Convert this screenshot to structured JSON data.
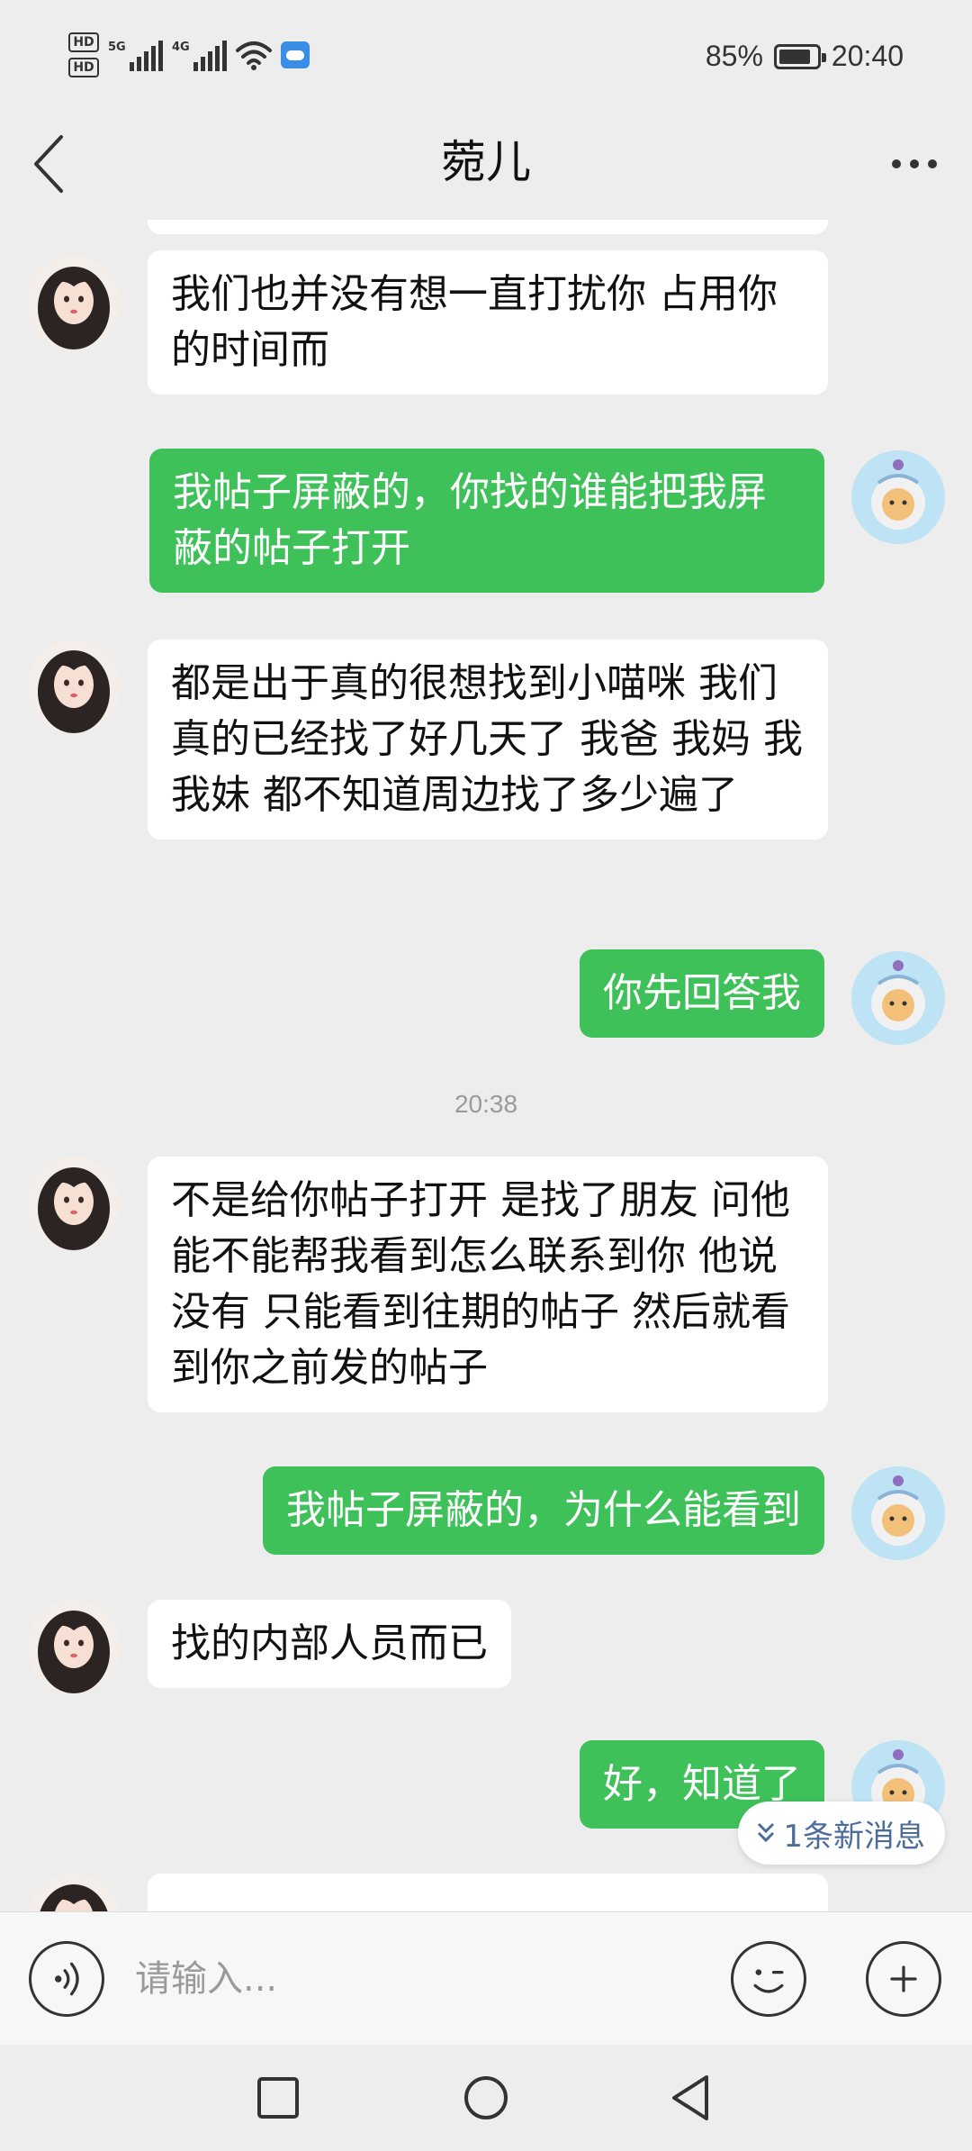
{
  "status_bar": {
    "hd1": "HD",
    "hd2": "HD",
    "sim1_net": "5G",
    "sim2_net": "4G",
    "battery": "85%",
    "time": "20:40"
  },
  "header": {
    "title": "菀儿"
  },
  "messages": [
    {
      "side": "in",
      "text": "我们也并没有想一直打扰你 占用你的时间而"
    },
    {
      "side": "out",
      "text": "我帖子屏蔽的，你找的谁能把我屏蔽的帖子打开"
    },
    {
      "side": "in",
      "text": "都是出于真的很想找到小喵咪 我们真的已经找了好几天了 我爸 我妈 我 我妹 都不知道周边找了多少遍了"
    },
    {
      "side": "out",
      "text": "你先回答我"
    },
    {
      "side": "in",
      "text": "不是给你帖子打开 是找了朋友 问他能不能帮我看到怎么联系到你 他说没有 只能看到往期的帖子 然后就看到你之前发的帖子"
    },
    {
      "side": "out",
      "text": "我帖子屏蔽的，为什么能看到"
    },
    {
      "side": "in",
      "text": "找的内部人员而已"
    },
    {
      "side": "out",
      "text": "好，知道了"
    }
  ],
  "timestamp": "20:38",
  "new_message_badge": "1条新消息",
  "input": {
    "placeholder": "请输入..."
  },
  "colors": {
    "outgoing_bubble": "#3fc15a",
    "incoming_bubble": "#ffffff",
    "background": "#ededed",
    "new_msg_text": "#4c6c9a"
  },
  "icons": [
    "back-arrow-icon",
    "more-icon",
    "voice-icon",
    "emoji-icon",
    "plus-icon",
    "nav-recents-icon",
    "nav-home-icon",
    "nav-back-icon"
  ]
}
